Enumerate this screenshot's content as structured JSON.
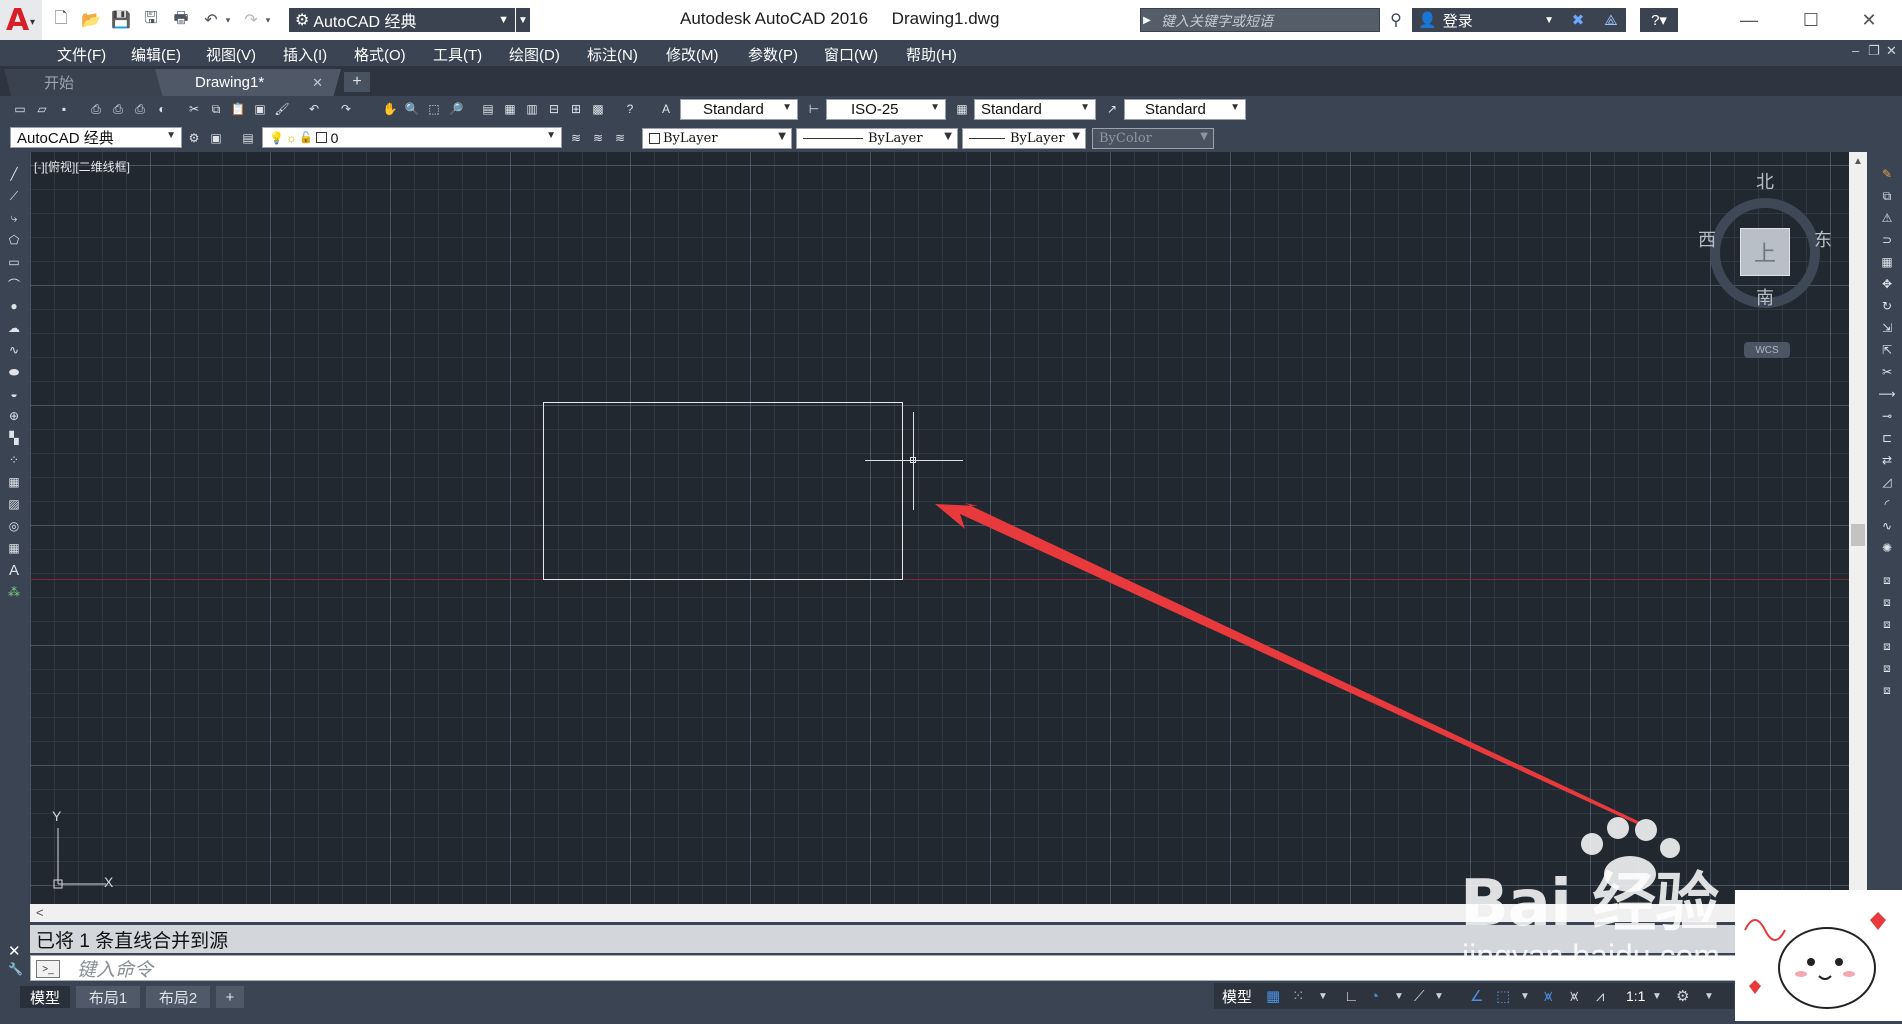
{
  "titlebar": {
    "workspace": "AutoCAD 经典",
    "app_title": "Autodesk AutoCAD 2016     Drawing1.dwg",
    "search_placeholder": "键入关键字或短语",
    "sign_in": "登录"
  },
  "menu": [
    "文件(F)",
    "编辑(E)",
    "视图(V)",
    "插入(I)",
    "格式(O)",
    "工具(T)",
    "绘图(D)",
    "标注(N)",
    "修改(M)",
    "参数(P)",
    "窗口(W)",
    "帮助(H)"
  ],
  "file_tabs": [
    {
      "label": "开始",
      "active": false
    },
    {
      "label": "Drawing1*",
      "active": true
    }
  ],
  "toolbar1": {
    "text_style": "Standard",
    "dim_style": "ISO-25",
    "table_style": "Standard",
    "mleader_style": "Standard"
  },
  "toolbar2": {
    "workspace": "AutoCAD 经典",
    "layer": "0",
    "color": "ByLayer",
    "linetype": "ByLayer",
    "lineweight": "ByLayer",
    "plotstyle": "ByColor"
  },
  "viewport": {
    "label": "[-][俯视][二维线框]",
    "viewcube": {
      "north": "北",
      "south": "南",
      "east": "东",
      "west": "西",
      "face": "上",
      "wcs": "WCS"
    },
    "ucs": {
      "x": "X",
      "y": "Y"
    }
  },
  "command": {
    "history": "已将  1  条直线合并到源",
    "placeholder": "键入命令"
  },
  "layout_tabs": [
    "模型",
    "布局1",
    "布局2"
  ],
  "status": {
    "model": "模型",
    "scale": "1:1"
  },
  "watermark": {
    "brand": "Bai 经验",
    "url": "jingyan.baidu.com"
  },
  "colors": {
    "accent_red": "#e8393c",
    "canvas_bg": "#212830",
    "ui_bg": "#3b4453"
  }
}
